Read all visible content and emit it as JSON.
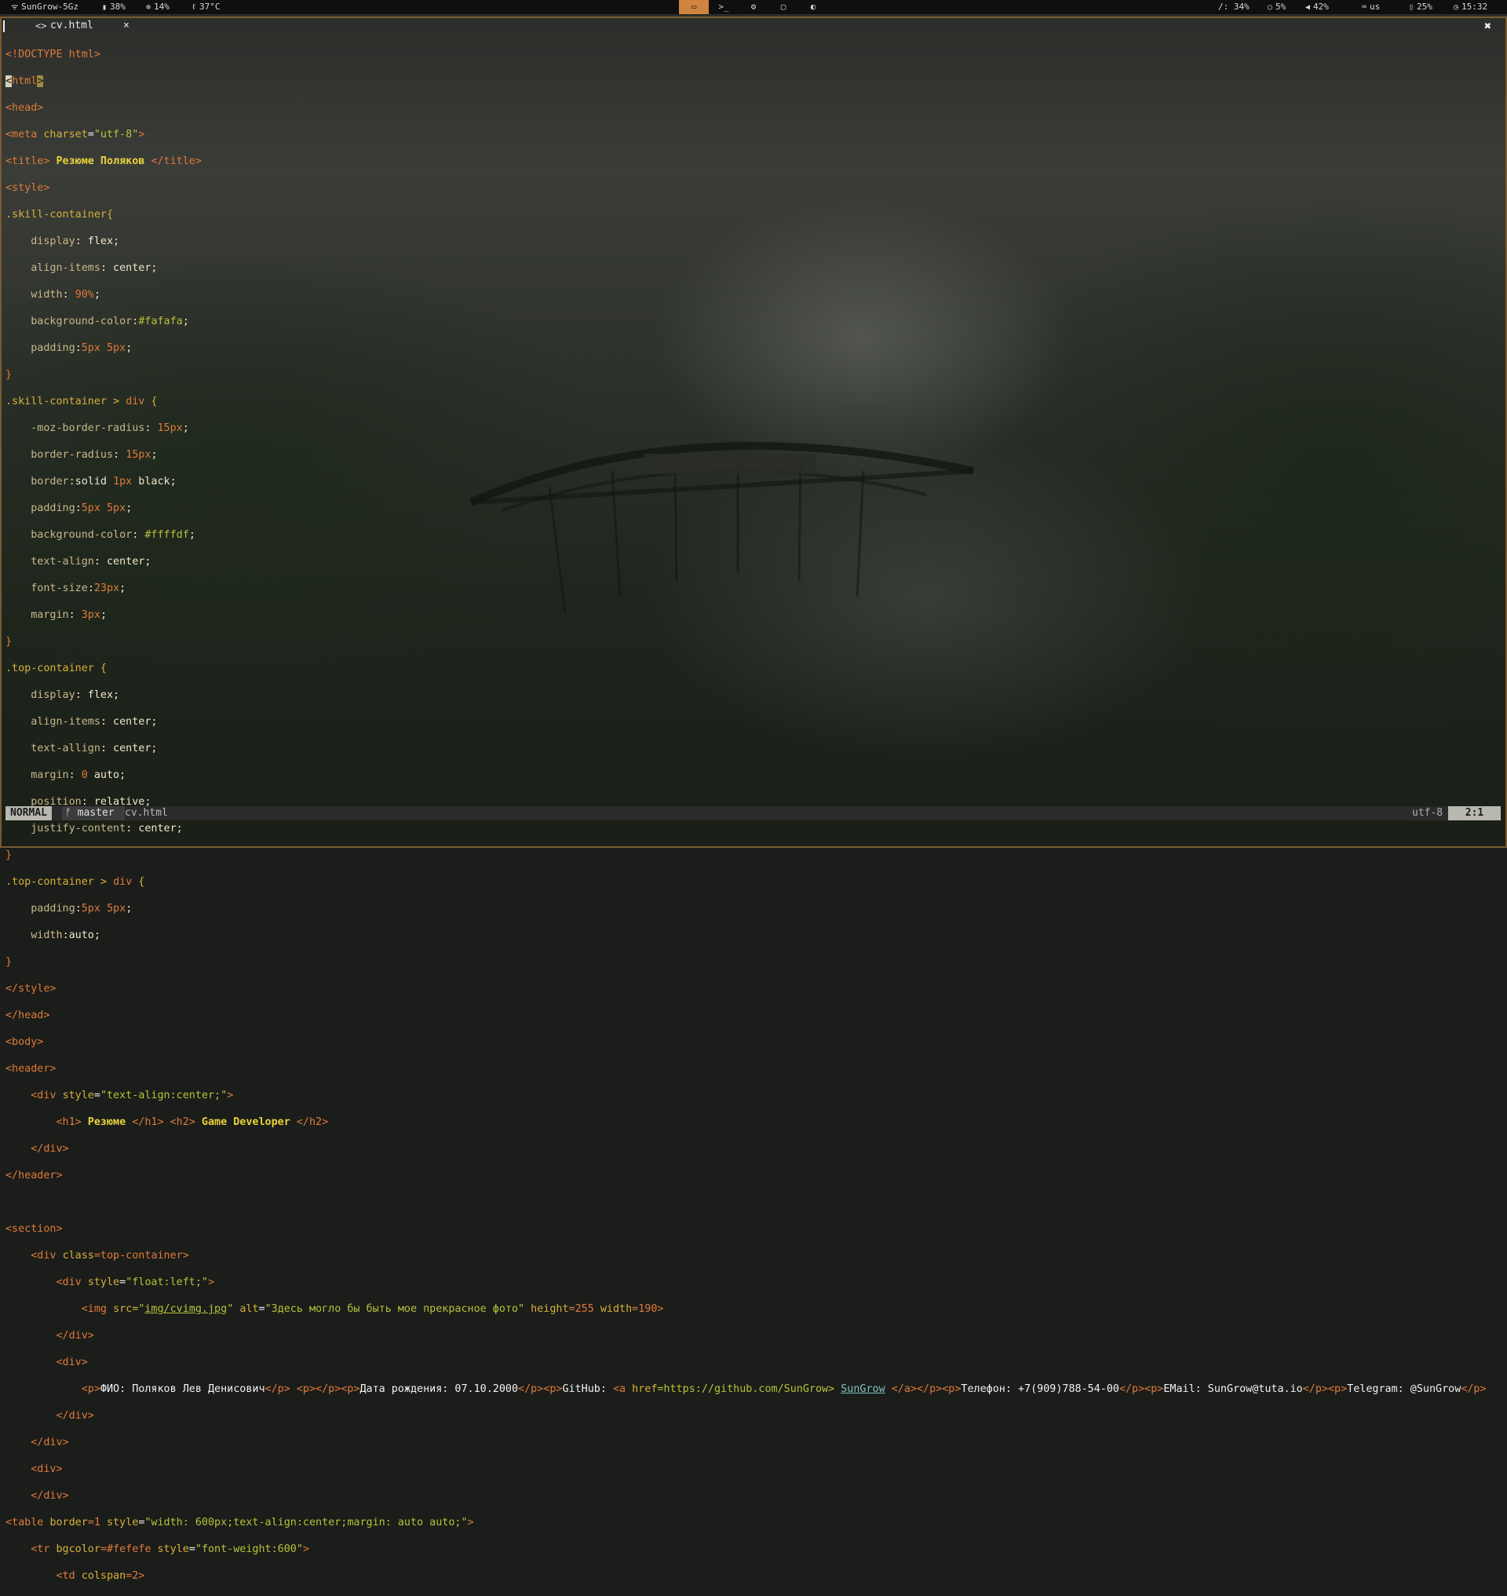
{
  "topbar": {
    "wifi": "SunGrow-5Gz",
    "memory": "38%",
    "cpu": "14%",
    "temperature": "37°C",
    "disk": "/: 34%",
    "load": "5%",
    "volume": "42%",
    "keyboard": "us",
    "battery": "25%",
    "time": "15:32",
    "workspaces": [
      "▭",
      ">_",
      "⚙",
      "▢",
      "◐"
    ]
  },
  "editor": {
    "tab_name": "cv.html",
    "tab_icon": "<>",
    "tab_close": "×",
    "window_close": "✖"
  },
  "code": {
    "l01a": "<!DOCTYPE html>",
    "l02_cursor": "<",
    "l02a": "html",
    "l02_match": ">",
    "l03": "<head>",
    "l04a": "<meta ",
    "l04b": "charset",
    "l04c": "=",
    "l04d": "\"utf-8\"",
    "l04e": ">",
    "l05a": "<title>",
    "l05b": " Резюме Поляков ",
    "l05c": "</title>",
    "l06": "<style>",
    "l07": ".skill-container{",
    "l08a": "    display",
    "l08b": ": flex;",
    "l09a": "    align-items",
    "l09b": ": center;",
    "l10a": "    width",
    "l10b": ": ",
    "l10c": "90%",
    "l10d": ";",
    "l11a": "    background-color",
    "l11b": ":",
    "l11c": "#fafafa",
    "l11d": ";",
    "l12a": "    padding",
    "l12b": ":",
    "l12c": "5px 5px",
    "l12d": ";",
    "l13": "}",
    "l14a": ".skill-container > ",
    "l14b": "div",
    "l14c": " {",
    "l15a": "    -moz-border-radius",
    "l15b": ": ",
    "l15c": "15px",
    "l15d": ";",
    "l16a": "    border-radius",
    "l16b": ": ",
    "l16c": "15px",
    "l16d": ";",
    "l17a": "    border",
    "l17b": ":solid ",
    "l17c": "1px",
    "l17d": " black;",
    "l18a": "    padding",
    "l18b": ":",
    "l18c": "5px 5px",
    "l18d": ";",
    "l19a": "    background-color",
    "l19b": ": ",
    "l19c": "#ffffdf",
    "l19d": ";",
    "l20a": "    text-align",
    "l20b": ": center;",
    "l21a": "    font-size",
    "l21b": ":",
    "l21c": "23px",
    "l21d": ";",
    "l22a": "    margin",
    "l22b": ": ",
    "l22c": "3px",
    "l22d": ";",
    "l23": "}",
    "l24": ".top-container {",
    "l25a": "    display",
    "l25b": ": flex;",
    "l26a": "    align-items",
    "l26b": ": center;",
    "l27a": "    text-allign",
    "l27b": ": center;",
    "l28a": "    margin",
    "l28b": ": ",
    "l28c": "0",
    "l28d": " auto;",
    "l29a": "    position",
    "l29b": ": relative;",
    "l30a": "    justify-content",
    "l30b": ": center;",
    "l31": "}",
    "l32a": ".top-container > ",
    "l32b": "div",
    "l32c": " {",
    "l33a": "    padding",
    "l33b": ":",
    "l33c": "5px 5px",
    "l33d": ";",
    "l34a": "    width",
    "l34b": ":auto;",
    "l35": "}",
    "l36": "</style>",
    "l37": "</head>",
    "l38": "<body>",
    "l39": "<header>",
    "l40a": "    <div ",
    "l40b": "style",
    "l40c": "=",
    "l40d": "\"text-align:center;\"",
    "l40e": ">",
    "l41a": "        <h1>",
    "l41b": " Резюме ",
    "l41c": "</h1>",
    "l41d": " <h2>",
    "l41e": " Game Developer ",
    "l41f": "</h2>",
    "l42": "    </div>",
    "l43": "</header>",
    "l44": "",
    "l45": "<section>",
    "l46a": "    <div ",
    "l46b": "class",
    "l46c": "=top-container>",
    "l47a": "        <div ",
    "l47b": "style",
    "l47c": "=",
    "l47d": "\"float:left;\"",
    "l47e": ">",
    "l48a": "            <img ",
    "l48b": "src",
    "l48c": "=\"",
    "l48d": "img/cvimg.jpg",
    "l48e": "\" ",
    "l48f": "alt",
    "l48g": "=",
    "l48h": "\"Здесь могло бы быть мое прекрасное фото\"",
    "l48i": " height",
    "l48j": "=255 ",
    "l48k": "width",
    "l48l": "=190>",
    "l49": "        </div>",
    "l50": "        <div>",
    "l51a": "            <p>",
    "l51b": "ФИО: Поляков Лев Денисович",
    "l51c": "</p> <p></p><p>",
    "l51d": "Дата рождения: 07.10.2000",
    "l51e": "</p><p>",
    "l51f": "GitHub: ",
    "l51g": "<a ",
    "l51h": "href",
    "l51i": "=https://github.com/SunGrow>",
    "l51j": " ",
    "l51k": "SunGrow",
    "l51l": " </a></p><p>",
    "l51m": "Телефон: +7(909)788-54-00",
    "l51n": "</p><p>",
    "l51o": "EMail: SunGrow@tuta.io",
    "l51p": "</p><p>",
    "l51q": "Telegram: @SunGrow",
    "l51r": "</p>",
    "l52": "        </div>",
    "l53": "    </div>",
    "l54": "    <div>",
    "l55": "    </div>",
    "l56a": "<table ",
    "l56b": "border",
    "l56c": "=1 ",
    "l56d": "style",
    "l56e": "=",
    "l56f": "\"width: 600px;text-align:center;margin: auto auto;\"",
    "l56g": ">",
    "l57a": "    <tr ",
    "l57b": "bgcolor",
    "l57c": "=#fefefe ",
    "l57d": "style",
    "l57e": "=",
    "l57f": "\"font-weight:600\"",
    "l57g": ">",
    "l58a": "        <td ",
    "l58b": "colspan",
    "l58c": "=2>"
  },
  "statusline": {
    "mode": "NORMAL",
    "branch_icon": "ᚠ",
    "branch": "master",
    "filename": "cv.html",
    "encoding": "utf-8",
    "position": "2:1"
  }
}
